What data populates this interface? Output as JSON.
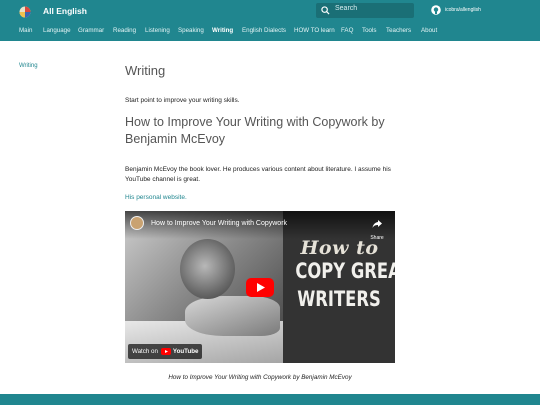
{
  "header": {
    "site_title": "All English",
    "search_placeholder": "Search",
    "repo_name": "icobra/allenglish"
  },
  "nav": [
    {
      "label": "Main"
    },
    {
      "label": "Language"
    },
    {
      "label": "Grammar"
    },
    {
      "label": "Reading"
    },
    {
      "label": "Listening"
    },
    {
      "label": "Speaking"
    },
    {
      "label": "Writing",
      "active": true
    },
    {
      "label": "English Dialects"
    },
    {
      "label": "HOW TO learn"
    },
    {
      "label": "FAQ"
    },
    {
      "label": "Tools"
    },
    {
      "label": "Teachers"
    },
    {
      "label": "About"
    }
  ],
  "sidebar": {
    "current": "Writing"
  },
  "main": {
    "page_title": "Writing",
    "intro": "Start point to improve your writing skills.",
    "article_title": "How to Improve Your Writing with Copywork by Benjamin McEvoy",
    "description": "Benjamin McEvoy the book lover. He produces various content about literature. I assume his YouTube channel is great.",
    "link_text": "His personal website.",
    "video": {
      "title": "How to Improve Your Writing with Copywork",
      "share_label": "Share",
      "thumb_line1": "How to",
      "thumb_line2": "COPY GREAT",
      "thumb_line3": "WRITERS",
      "watch_on": "Watch on",
      "youtube": "YouTube"
    },
    "caption": "How to Improve Your Writing with Copywork by Benjamin McEvoy"
  },
  "colors": {
    "accent": "#20868f",
    "play_red": "#ff0000"
  }
}
